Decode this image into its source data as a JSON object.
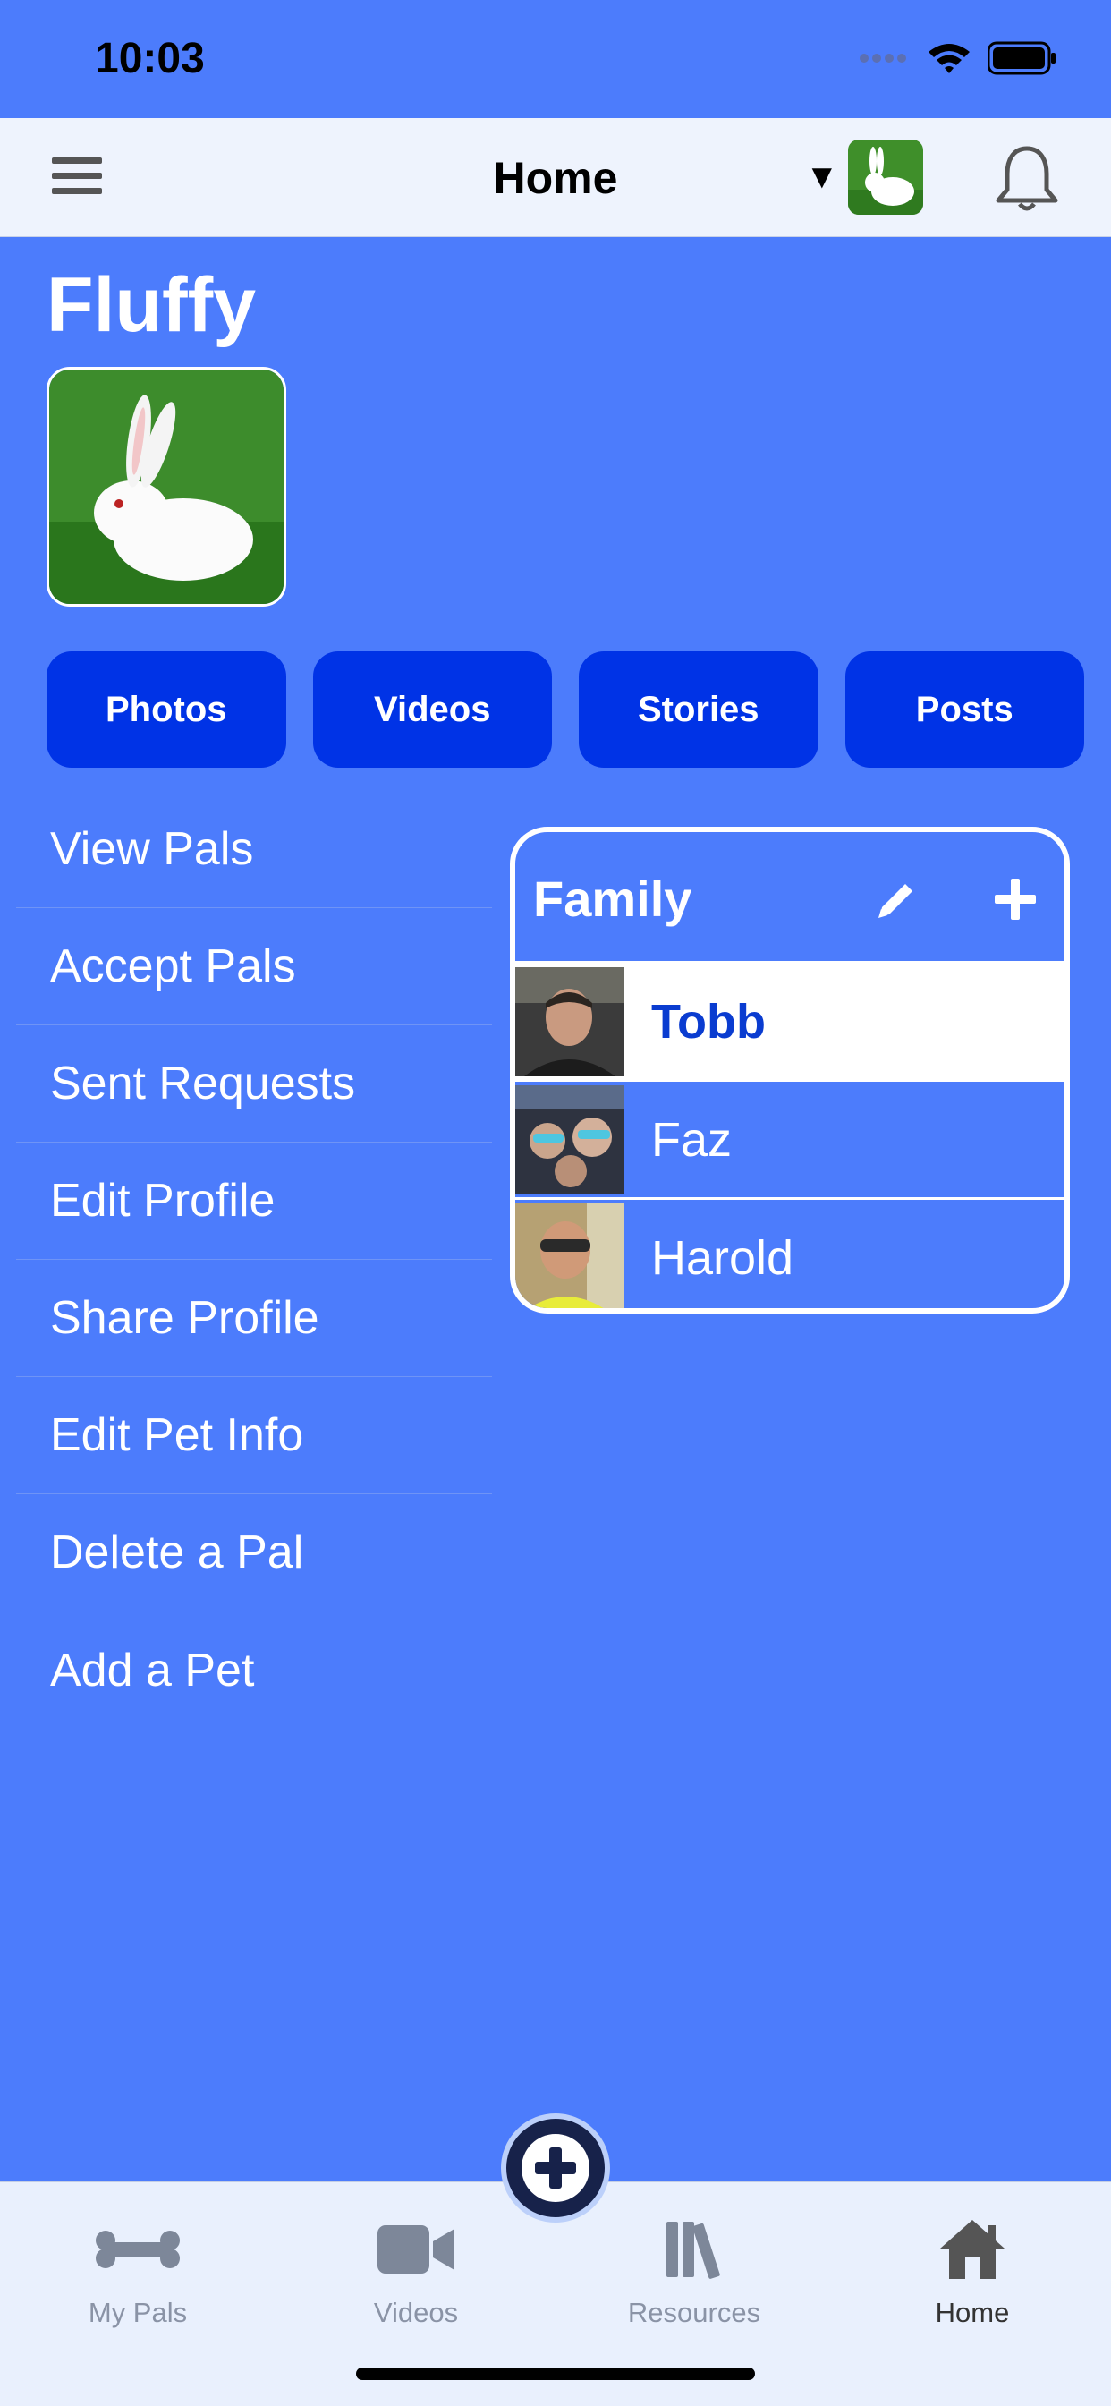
{
  "status_bar": {
    "time": "10:03"
  },
  "nav": {
    "title": "Home",
    "caret": "▼"
  },
  "pet": {
    "name": "Fluffy"
  },
  "media_buttons": [
    {
      "label": "Photos"
    },
    {
      "label": "Videos"
    },
    {
      "label": "Stories"
    },
    {
      "label": "Posts"
    }
  ],
  "menu": {
    "items": [
      {
        "label": "View Pals"
      },
      {
        "label": "Accept Pals"
      },
      {
        "label": "Sent Requests"
      },
      {
        "label": "Edit Profile"
      },
      {
        "label": "Share Profile"
      },
      {
        "label": "Edit Pet Info"
      },
      {
        "label": "Delete a Pal"
      },
      {
        "label": "Add a Pet"
      }
    ]
  },
  "group": {
    "title": "Family",
    "members": [
      {
        "name": "Tobb",
        "selected": true
      },
      {
        "name": "Faz",
        "selected": false
      },
      {
        "name": "Harold",
        "selected": false
      }
    ]
  },
  "tab_bar": {
    "tabs": [
      {
        "label": "My Pals",
        "icon": "bone-icon"
      },
      {
        "label": "Videos",
        "icon": "video-camera-icon"
      },
      {
        "label": "Resources",
        "icon": "books-icon"
      },
      {
        "label": "Home",
        "icon": "house-icon",
        "active": true
      }
    ]
  },
  "colors": {
    "background": "#4c7cfc",
    "button": "#0033e6",
    "selected_text": "#0a3cd0"
  }
}
